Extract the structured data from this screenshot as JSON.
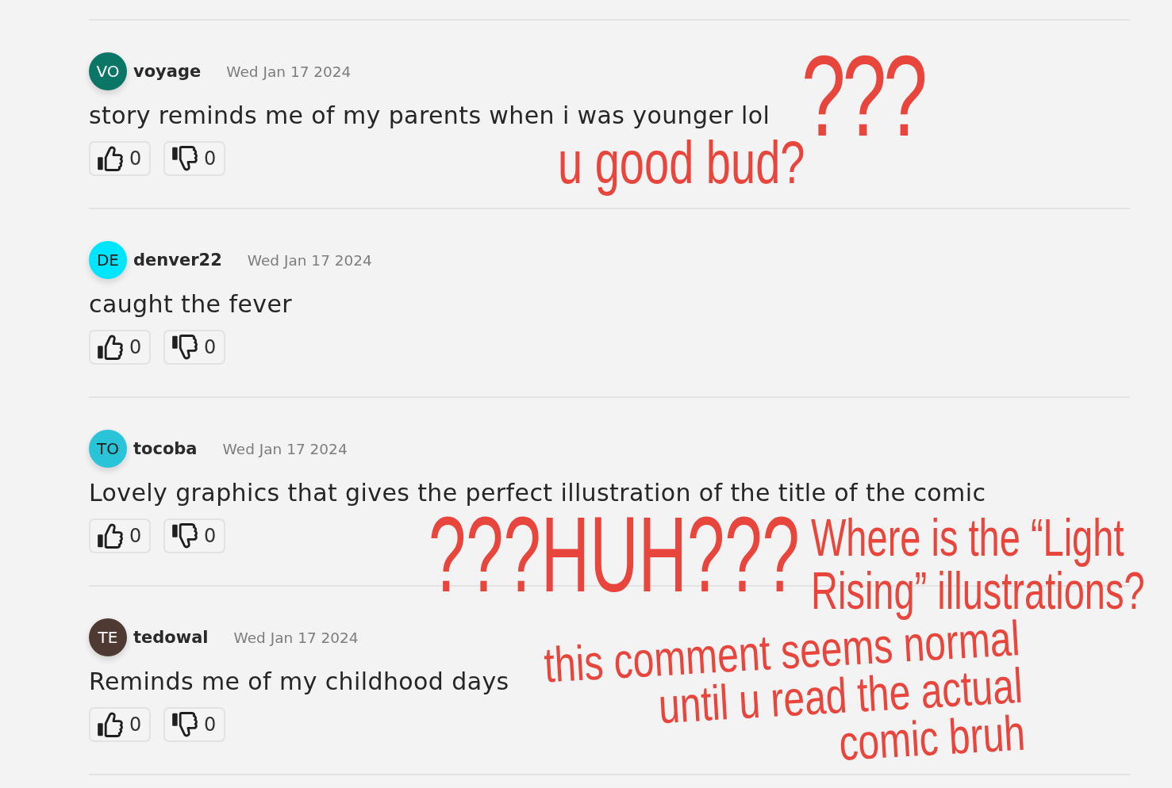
{
  "comments": [
    {
      "avatar": {
        "initials": "VO",
        "color": "#0b7566"
      },
      "username": "voyage",
      "date": "Wed Jan 17 2024",
      "text": "story reminds me of my parents when i was younger lol",
      "likes": "0",
      "dislikes": "0",
      "annotations": [
        {
          "text": "???"
        },
        {
          "text": "u good bud?"
        }
      ]
    },
    {
      "avatar": {
        "initials": "DE",
        "color": "#00e5ff"
      },
      "username": "denver22",
      "date": "Wed Jan 17 2024",
      "text": "caught the fever",
      "likes": "0",
      "dislikes": "0"
    },
    {
      "avatar": {
        "initials": "TO",
        "color": "#29c4d8"
      },
      "username": "tocoba",
      "date": "Wed Jan 17 2024",
      "text": "Lovely graphics that gives the perfect illustration of the title of the comic",
      "likes": "0",
      "dislikes": "0",
      "annotations": [
        {
          "text": "???HUH???"
        },
        {
          "text": "Where is the “Light\nRising” illustrations?"
        }
      ]
    },
    {
      "avatar": {
        "initials": "TE",
        "color": "#4e3a32"
      },
      "username": "tedowal",
      "date": "Wed Jan 17 2024",
      "text": "Reminds me of my childhood days",
      "likes": "0",
      "dislikes": "0",
      "annotations": [
        {
          "text": "this comment seems normal\nuntil u read the actual\ncomic bruh"
        }
      ]
    }
  ]
}
